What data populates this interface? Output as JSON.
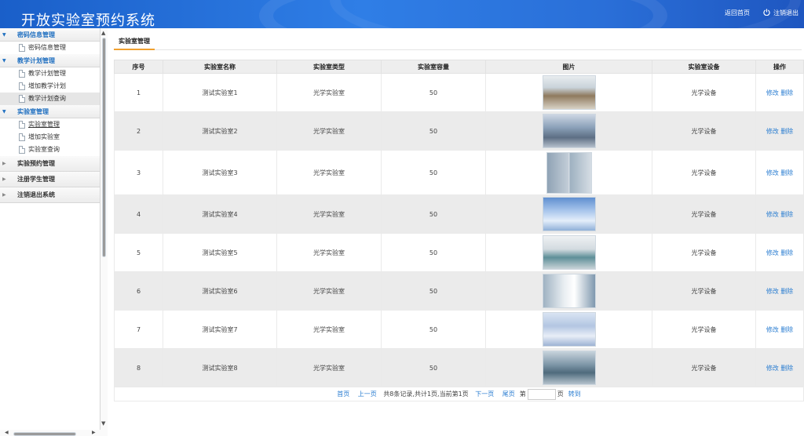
{
  "header": {
    "title": "开放实验室预约系统",
    "home_link": "返回首页",
    "logout_link": "注销退出"
  },
  "sidebar": {
    "groups": [
      {
        "label": "密码信息管理",
        "expanded": true,
        "items": [
          {
            "label": "密码信息管理"
          }
        ]
      },
      {
        "label": "教学计划管理",
        "expanded": true,
        "items": [
          {
            "label": "教学计划管理"
          },
          {
            "label": "增加教学计划"
          },
          {
            "label": "教学计划查询"
          }
        ]
      },
      {
        "label": "实验室管理",
        "expanded": true,
        "items": [
          {
            "label": "实验室管理"
          },
          {
            "label": "增加实验室"
          },
          {
            "label": "实验室查询"
          }
        ]
      },
      {
        "label": "实验预约管理",
        "expanded": false,
        "items": []
      },
      {
        "label": "注册学生管理",
        "expanded": false,
        "items": []
      },
      {
        "label": "注销退出系统",
        "expanded": false,
        "items": []
      }
    ]
  },
  "main": {
    "tab": "实验室管理",
    "columns": [
      "序号",
      "实验室名称",
      "实验室类型",
      "实验室容量",
      "图片",
      "实验室设备",
      "操作"
    ],
    "rows": [
      {
        "no": "1",
        "name": "测试实验室1",
        "type": "光学实验室",
        "capacity": "50",
        "equipment": "光学设备",
        "edit": "修改",
        "delete": "删除"
      },
      {
        "no": "2",
        "name": "测试实验室2",
        "type": "光学实验室",
        "capacity": "50",
        "equipment": "光学设备",
        "edit": "修改",
        "delete": "删除"
      },
      {
        "no": "3",
        "name": "测试实验室3",
        "type": "光学实验室",
        "capacity": "50",
        "equipment": "光学设备",
        "edit": "修改",
        "delete": "删除"
      },
      {
        "no": "4",
        "name": "测试实验室4",
        "type": "光学实验室",
        "capacity": "50",
        "equipment": "光学设备",
        "edit": "修改",
        "delete": "删除"
      },
      {
        "no": "5",
        "name": "测试实验室5",
        "type": "光学实验室",
        "capacity": "50",
        "equipment": "光学设备",
        "edit": "修改",
        "delete": "删除"
      },
      {
        "no": "6",
        "name": "测试实验室6",
        "type": "光学实验室",
        "capacity": "50",
        "equipment": "光学设备",
        "edit": "修改",
        "delete": "删除"
      },
      {
        "no": "7",
        "name": "测试实验室7",
        "type": "光学实验室",
        "capacity": "50",
        "equipment": "光学设备",
        "edit": "修改",
        "delete": "删除"
      },
      {
        "no": "8",
        "name": "测试实验室8",
        "type": "光学实验室",
        "capacity": "50",
        "equipment": "光学设备",
        "edit": "修改",
        "delete": "删除"
      }
    ],
    "pager": {
      "first": "首页",
      "prev": "上一页",
      "summary": "共8条记录,共计1页,当前第1页",
      "next": "下一页",
      "last": "尾页",
      "page_label": "第",
      "page_suffix": "页",
      "go": "转到"
    }
  },
  "colors": {
    "header": "#2f7ee6",
    "link": "#2a7dd1",
    "tab_underline": "#f0a030",
    "group_label": "#1f6fc0"
  }
}
